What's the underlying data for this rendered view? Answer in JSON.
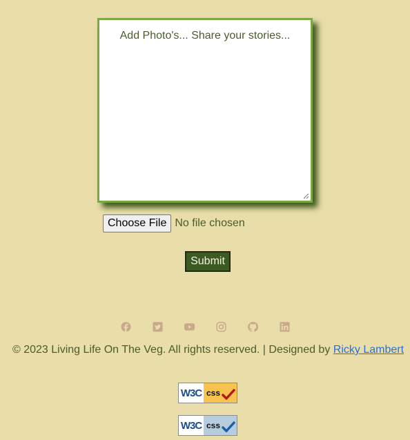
{
  "story_form": {
    "placeholder": "Add Photo's... Share your stories...",
    "file_button_label": "Choose File",
    "file_status": "No file chosen",
    "submit_label": "Submit"
  },
  "social": {
    "icons": [
      "facebook-icon",
      "twitter-icon",
      "youtube-icon",
      "instagram-icon",
      "github-icon",
      "linkedin-icon"
    ],
    "icon_color": "#c9a98c"
  },
  "footer": {
    "copyright": "© 2023 Living Life On The Veg. All rights reserved. | Designed by ",
    "designer_name": "Ricky Lambert"
  },
  "badges": [
    {
      "logo": "W3C",
      "label": "css",
      "accent": "#f6c34f",
      "check_color": "#b31b1b"
    },
    {
      "logo": "W3C",
      "label": "css",
      "accent": "#b6cde0",
      "check_color": "#1d5fa5"
    }
  ]
}
